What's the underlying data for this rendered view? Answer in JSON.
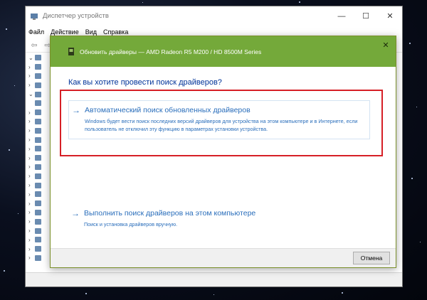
{
  "device_manager": {
    "title": "Диспетчер устройств",
    "menu": [
      "Файл",
      "Действие",
      "Вид",
      "Справка"
    ],
    "window_controls": {
      "minimize": "—",
      "maximize": "☐",
      "close": "✕"
    }
  },
  "dialog": {
    "title": "Обновить драйверы — AMD Radeon R5 M200 / HD 8500M Series",
    "close": "✕",
    "question": "Как вы хотите провести поиск драйверов?",
    "options": [
      {
        "arrow": "→",
        "title": "Автоматический поиск обновленных драйверов",
        "description": "Windows будет вести поиск последних версий драйверов для устройства на этом компьютере и в Интернете, если пользователь не отключил эту функцию в параметрах установки устройства."
      },
      {
        "arrow": "→",
        "title": "Выполнить поиск драйверов на этом компьютере",
        "description": "Поиск и установка драйверов вручную."
      }
    ],
    "cancel_label": "Отмена"
  },
  "colors": {
    "header_green": "#74a93a",
    "link_blue": "#2a6ebb",
    "highlight_red": "#d61f26"
  }
}
